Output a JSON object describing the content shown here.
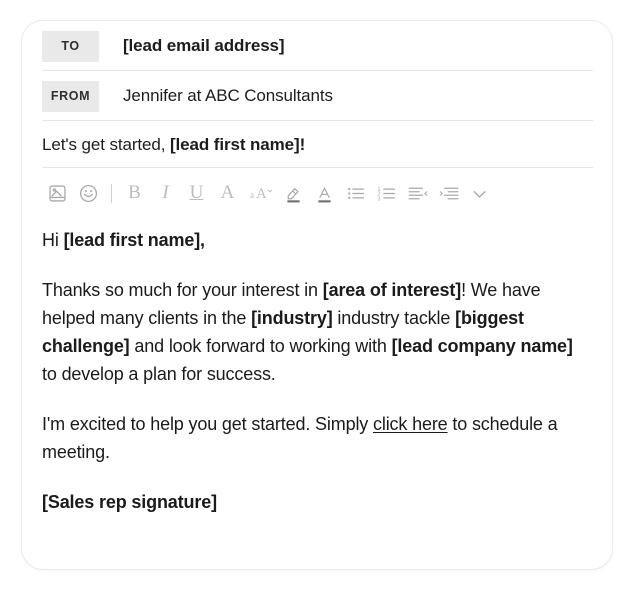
{
  "card": {
    "to": {
      "label": "TO",
      "value": "[lead email address]"
    },
    "from": {
      "label": "FROM",
      "value": "Jennifer at ABC Consultants"
    },
    "subject": {
      "prefix": "Let's get started, ",
      "placeholder": "[lead first name]",
      "suffix": "!"
    }
  },
  "toolbar": {
    "items": [
      {
        "name": "insert-image-icon",
        "label": "Insert image"
      },
      {
        "name": "emoji-icon",
        "label": "Insert emoji"
      },
      {
        "name": "bold-button",
        "label": "B"
      },
      {
        "name": "italic-button",
        "label": "I"
      },
      {
        "name": "underline-button",
        "label": "U"
      },
      {
        "name": "font-family-button",
        "label": "A"
      },
      {
        "name": "font-size-icon",
        "label": "aA"
      },
      {
        "name": "highlight-color-icon",
        "label": "Highlight"
      },
      {
        "name": "text-color-icon",
        "label": "Text color"
      },
      {
        "name": "bulleted-list-icon",
        "label": "Bulleted list"
      },
      {
        "name": "numbered-list-icon",
        "label": "Numbered list"
      },
      {
        "name": "align-icon",
        "label": "Align"
      },
      {
        "name": "indent-icon",
        "label": "Indent"
      },
      {
        "name": "more-options-chevron-icon",
        "label": "More"
      }
    ]
  },
  "body": {
    "greeting": {
      "prefix": "Hi ",
      "placeholder": "[lead first name]",
      "suffix": ","
    },
    "paragraph1": {
      "part1": "Thanks so much for your interest in ",
      "bold1": "[area of interest]",
      "part2": "! We have helped many clients in the ",
      "bold2": "[industry]",
      "part3": " industry tackle ",
      "bold3": "[biggest challenge]",
      "part4": " and look forward to working with ",
      "bold4": "[lead company name]",
      "part5": " to develop a plan for success."
    },
    "paragraph2": {
      "part1": "I'm excited to help you get started. Simply ",
      "link": "click here",
      "part2": " to schedule a meeting."
    },
    "signature": "[Sales rep signature]"
  }
}
